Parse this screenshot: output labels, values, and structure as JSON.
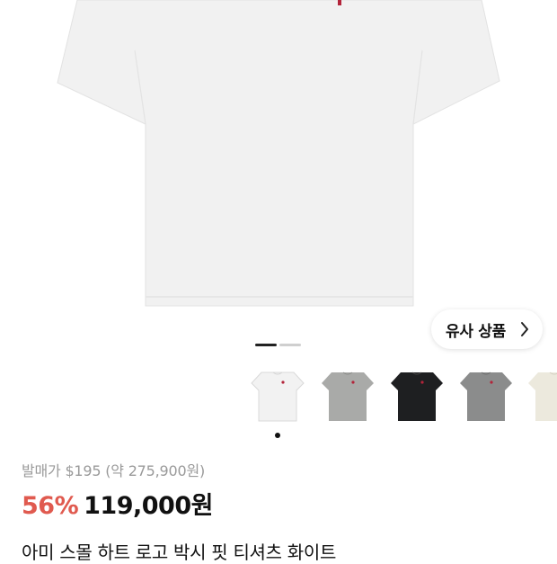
{
  "product_image": {
    "alt": "white t-shirt",
    "shirt_color": "#f1f1f1",
    "logo_color": "#b3243a"
  },
  "similar_button": {
    "label": "유사 상품",
    "icon": "chevron-right-icon"
  },
  "carousel": {
    "total": 2,
    "active": 1
  },
  "color_thumbnails": [
    {
      "name": "white",
      "color": "#f2f2f2"
    },
    {
      "name": "light-gray",
      "color": "#a9aaa8"
    },
    {
      "name": "black",
      "color": "#1e1f21"
    },
    {
      "name": "gray",
      "color": "#8b8c8c"
    },
    {
      "name": "cream",
      "color": "#ece9dd"
    }
  ],
  "selected_thumbnail": 1,
  "pricing": {
    "original_label": "발매가 $195 (약 275,900원)",
    "discount": "56%",
    "price": "119,000원",
    "discount_color": "#e05a4f"
  },
  "product_title": "아미 스몰 하트 로고 박시 핏 티셔츠 화이트"
}
